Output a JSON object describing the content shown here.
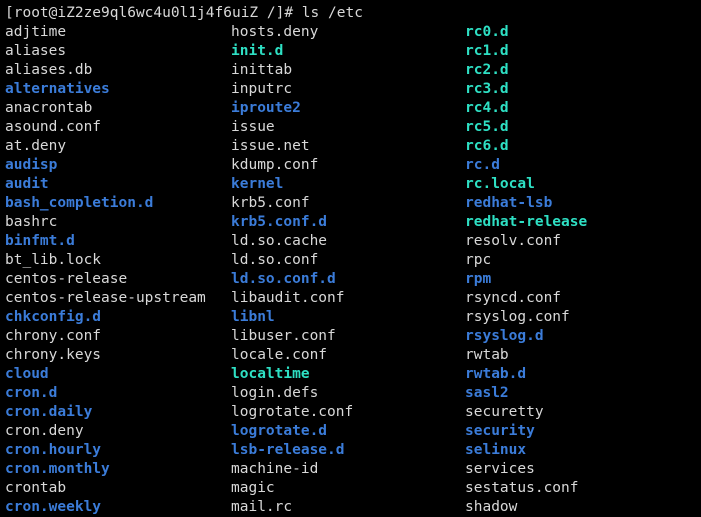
{
  "terminal": {
    "title": "Terminal",
    "background_color": "#000000",
    "colors": {
      "file": "#d8d8d8",
      "directory": "#3b7cd9",
      "symlink": "#2ee0c4"
    },
    "prompt": {
      "user": "root",
      "host": "iZ2ze9ql6wc4u0l1j4f6uiZ",
      "cwd": "/",
      "symbol": "#",
      "command": "ls /etc",
      "full_text": "[root@iZ2ze9ql6wc4u0l1j4f6uiZ /]# ls /etc"
    },
    "rows": [
      [
        {
          "name": "adjtime",
          "type": "file"
        },
        {
          "name": "hosts.deny",
          "type": "file"
        },
        {
          "name": "rc0.d",
          "type": "symlink"
        }
      ],
      [
        {
          "name": "aliases",
          "type": "file"
        },
        {
          "name": "init.d",
          "type": "symlink"
        },
        {
          "name": "rc1.d",
          "type": "symlink"
        }
      ],
      [
        {
          "name": "aliases.db",
          "type": "file"
        },
        {
          "name": "inittab",
          "type": "file"
        },
        {
          "name": "rc2.d",
          "type": "symlink"
        }
      ],
      [
        {
          "name": "alternatives",
          "type": "directory"
        },
        {
          "name": "inputrc",
          "type": "file"
        },
        {
          "name": "rc3.d",
          "type": "symlink"
        }
      ],
      [
        {
          "name": "anacrontab",
          "type": "file"
        },
        {
          "name": "iproute2",
          "type": "directory"
        },
        {
          "name": "rc4.d",
          "type": "symlink"
        }
      ],
      [
        {
          "name": "asound.conf",
          "type": "file"
        },
        {
          "name": "issue",
          "type": "file"
        },
        {
          "name": "rc5.d",
          "type": "symlink"
        }
      ],
      [
        {
          "name": "at.deny",
          "type": "file"
        },
        {
          "name": "issue.net",
          "type": "file"
        },
        {
          "name": "rc6.d",
          "type": "symlink"
        }
      ],
      [
        {
          "name": "audisp",
          "type": "directory"
        },
        {
          "name": "kdump.conf",
          "type": "file"
        },
        {
          "name": "rc.d",
          "type": "directory"
        }
      ],
      [
        {
          "name": "audit",
          "type": "directory"
        },
        {
          "name": "kernel",
          "type": "directory"
        },
        {
          "name": "rc.local",
          "type": "symlink"
        }
      ],
      [
        {
          "name": "bash_completion.d",
          "type": "directory"
        },
        {
          "name": "krb5.conf",
          "type": "file"
        },
        {
          "name": "redhat-lsb",
          "type": "directory"
        }
      ],
      [
        {
          "name": "bashrc",
          "type": "file"
        },
        {
          "name": "krb5.conf.d",
          "type": "directory"
        },
        {
          "name": "redhat-release",
          "type": "symlink"
        }
      ],
      [
        {
          "name": "binfmt.d",
          "type": "directory"
        },
        {
          "name": "ld.so.cache",
          "type": "file"
        },
        {
          "name": "resolv.conf",
          "type": "file"
        }
      ],
      [
        {
          "name": "bt_lib.lock",
          "type": "file"
        },
        {
          "name": "ld.so.conf",
          "type": "file"
        },
        {
          "name": "rpc",
          "type": "file"
        }
      ],
      [
        {
          "name": "centos-release",
          "type": "file"
        },
        {
          "name": "ld.so.conf.d",
          "type": "directory"
        },
        {
          "name": "rpm",
          "type": "directory"
        }
      ],
      [
        {
          "name": "centos-release-upstream",
          "type": "file"
        },
        {
          "name": "libaudit.conf",
          "type": "file"
        },
        {
          "name": "rsyncd.conf",
          "type": "file"
        }
      ],
      [
        {
          "name": "chkconfig.d",
          "type": "directory"
        },
        {
          "name": "libnl",
          "type": "directory"
        },
        {
          "name": "rsyslog.conf",
          "type": "file"
        }
      ],
      [
        {
          "name": "chrony.conf",
          "type": "file"
        },
        {
          "name": "libuser.conf",
          "type": "file"
        },
        {
          "name": "rsyslog.d",
          "type": "directory"
        }
      ],
      [
        {
          "name": "chrony.keys",
          "type": "file"
        },
        {
          "name": "locale.conf",
          "type": "file"
        },
        {
          "name": "rwtab",
          "type": "file"
        }
      ],
      [
        {
          "name": "cloud",
          "type": "directory"
        },
        {
          "name": "localtime",
          "type": "symlink"
        },
        {
          "name": "rwtab.d",
          "type": "directory"
        }
      ],
      [
        {
          "name": "cron.d",
          "type": "directory"
        },
        {
          "name": "login.defs",
          "type": "file"
        },
        {
          "name": "sasl2",
          "type": "directory"
        }
      ],
      [
        {
          "name": "cron.daily",
          "type": "directory"
        },
        {
          "name": "logrotate.conf",
          "type": "file"
        },
        {
          "name": "securetty",
          "type": "file"
        }
      ],
      [
        {
          "name": "cron.deny",
          "type": "file"
        },
        {
          "name": "logrotate.d",
          "type": "directory"
        },
        {
          "name": "security",
          "type": "directory"
        }
      ],
      [
        {
          "name": "cron.hourly",
          "type": "directory"
        },
        {
          "name": "lsb-release.d",
          "type": "directory"
        },
        {
          "name": "selinux",
          "type": "directory"
        }
      ],
      [
        {
          "name": "cron.monthly",
          "type": "directory"
        },
        {
          "name": "machine-id",
          "type": "file"
        },
        {
          "name": "services",
          "type": "file"
        }
      ],
      [
        {
          "name": "crontab",
          "type": "file"
        },
        {
          "name": "magic",
          "type": "file"
        },
        {
          "name": "sestatus.conf",
          "type": "file"
        }
      ],
      [
        {
          "name": "cron.weekly",
          "type": "directory"
        },
        {
          "name": "mail.rc",
          "type": "file"
        },
        {
          "name": "shadow",
          "type": "file"
        }
      ]
    ]
  }
}
